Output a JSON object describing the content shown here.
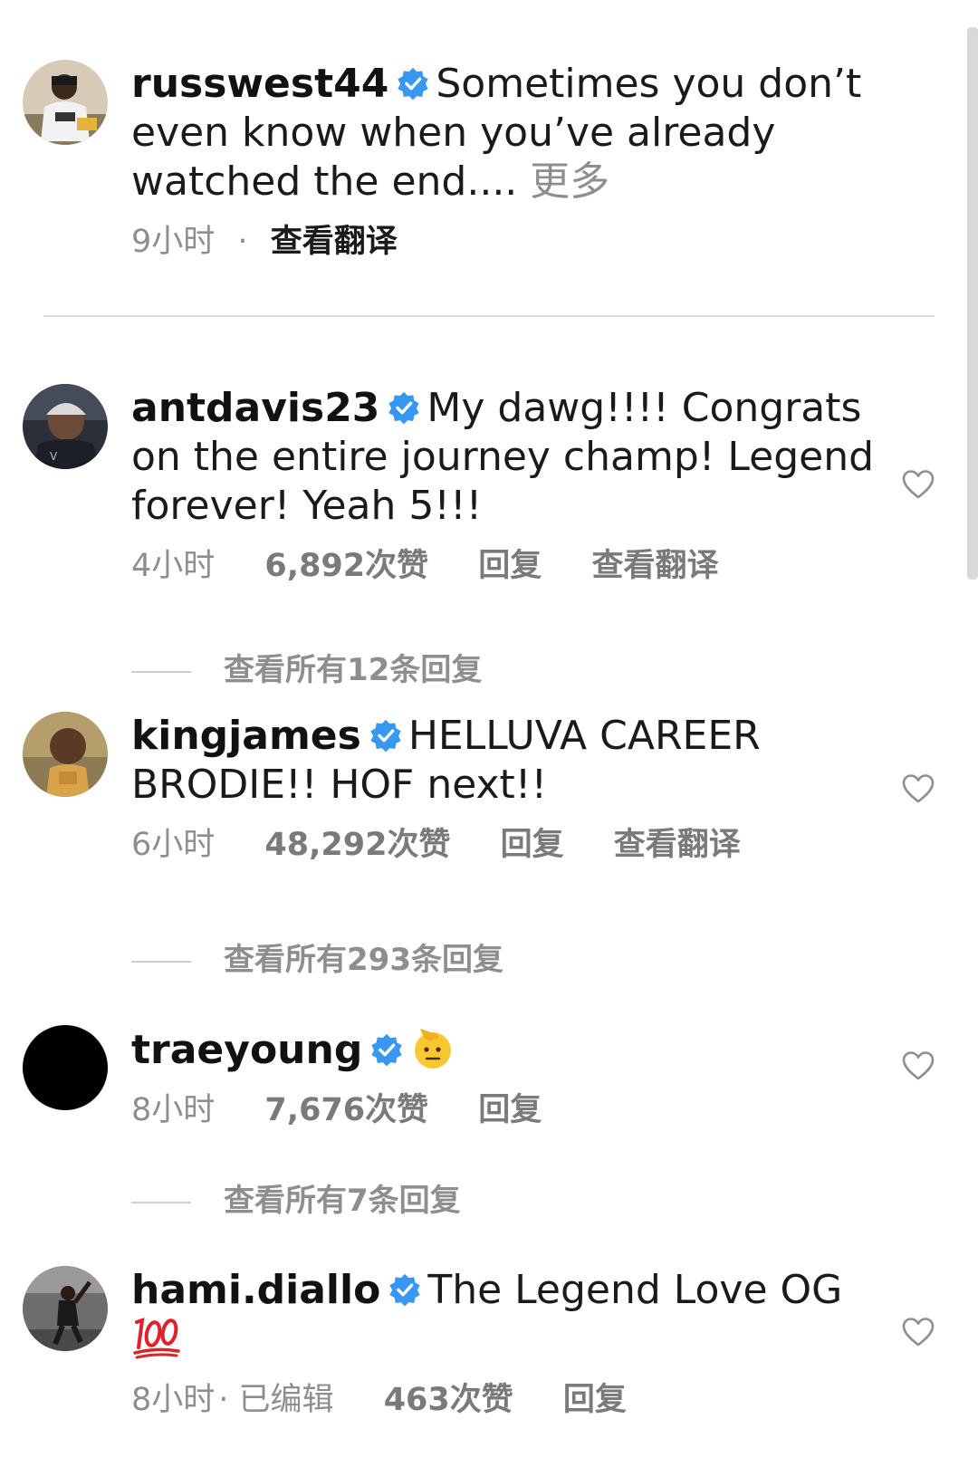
{
  "caption": {
    "username": "russwest44",
    "text": "Sometimes you don’t even know when you’ve already watched the end....",
    "more": "更多",
    "time": "9小时",
    "separator": "·",
    "translate": "查看翻译"
  },
  "comments": [
    {
      "username": "antdavis23",
      "text": "My dawg!!!! Congrats on the entire journey champ! Legend forever! Yeah 5!!!",
      "time": "4小时",
      "likes": "6,892次赞",
      "reply": "回复",
      "translate": "查看翻译",
      "view_replies": "查看所有12条回复"
    },
    {
      "username": "kingjames",
      "text": "HELLUVA CAREER BRODIE!! HOF next!!",
      "time": "6小时",
      "likes": "48,292次赞",
      "reply": "回复",
      "translate": "查看翻译",
      "view_replies": "查看所有293条回复"
    },
    {
      "username": "traeyoung",
      "text": "",
      "emoji": "saluting-face-emoji",
      "time": "8小时",
      "likes": "7,676次赞",
      "reply": "回复",
      "view_replies": "查看所有7条回复"
    },
    {
      "username": "hami.diallo",
      "text": "The Legend Love OG",
      "emoji": "hundred-points-emoji",
      "time": "8小时",
      "edited": "· 已编辑",
      "likes": "463次赞",
      "reply": "回复"
    }
  ],
  "colors": {
    "verified": "#3897f0",
    "meta_text": "#8e8e8e",
    "hundred_red": "#e0202a"
  }
}
